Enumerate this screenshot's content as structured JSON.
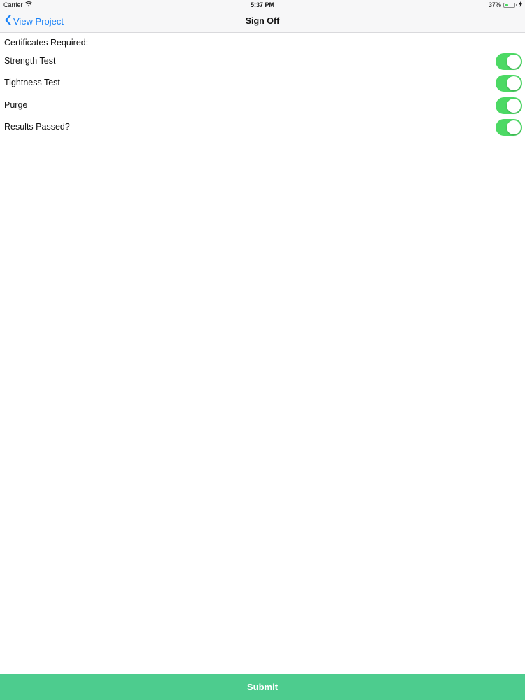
{
  "status_bar": {
    "carrier": "Carrier",
    "time": "5:37 PM",
    "battery_text": "37%",
    "battery_level": 0.37,
    "icons": [
      "wifi-icon",
      "battery-icon",
      "charging-icon"
    ]
  },
  "nav": {
    "back_label": "View Project",
    "back_icon": "chevron-left-icon",
    "title": "Sign Off"
  },
  "content": {
    "section_label": "Certificates Required:",
    "toggles": [
      {
        "label": "Strength Test",
        "on": true
      },
      {
        "label": "Tightness Test",
        "on": true
      },
      {
        "label": "Purge",
        "on": true
      },
      {
        "label": "Results Passed?",
        "on": true
      }
    ]
  },
  "footer": {
    "submit_label": "Submit"
  },
  "colors": {
    "accent_blue": "#1a82f7",
    "toggle_on": "#4cd964",
    "submit_bg": "#4dcc8e",
    "nav_bg": "#f7f7f8"
  }
}
